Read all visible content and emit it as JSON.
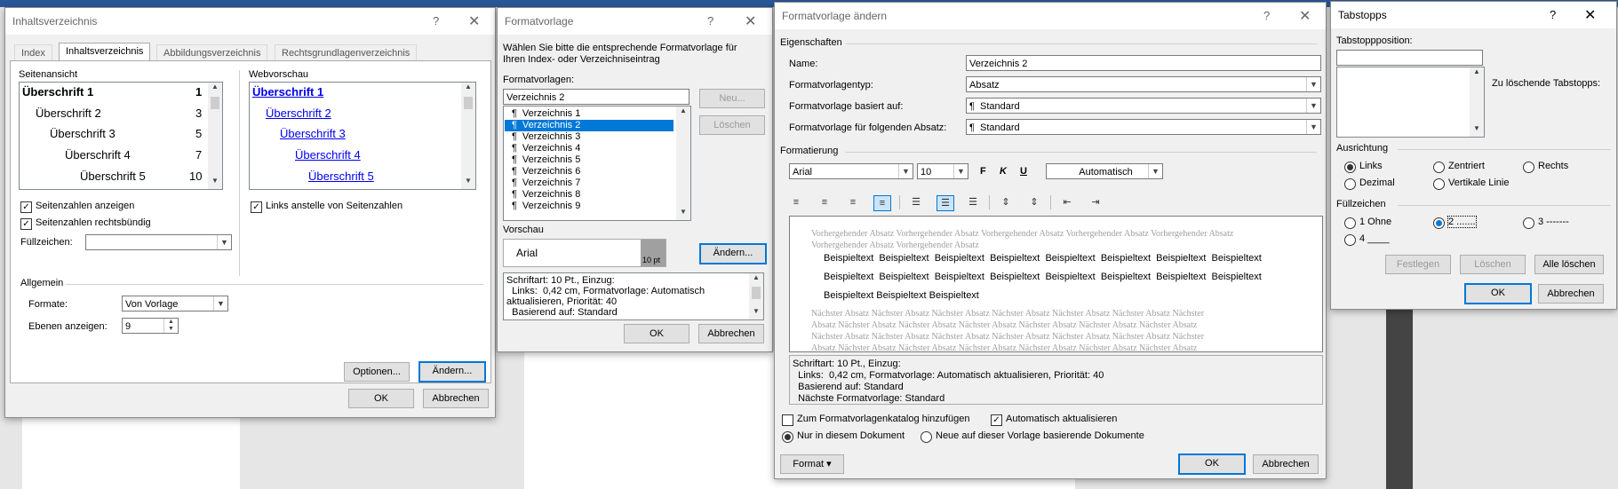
{
  "dlg1": {
    "title": "Inhaltsverzeichnis",
    "help": "?",
    "close": "✕",
    "tabs": [
      "Index",
      "Inhaltsverzeichnis",
      "Abbildungsverzeichnis",
      "Rechtsgrundlagenverzeichnis"
    ],
    "print_preview_label": "Seitenansicht",
    "print_preview": [
      {
        "text": "Überschrift 1",
        "page": "1"
      },
      {
        "text": "Überschrift 2",
        "page": "3"
      },
      {
        "text": "Überschrift 3",
        "page": "5"
      },
      {
        "text": "Überschrift 4",
        "page": "7"
      },
      {
        "text": "Überschrift 5",
        "page": "10"
      }
    ],
    "web_preview_label": "Webvorschau",
    "web_preview": [
      "Überschrift 1",
      "Überschrift 2",
      "Überschrift 3",
      "Überschrift 4",
      "Überschrift 5"
    ],
    "show_page_numbers": "Seitenzahlen anzeigen",
    "right_align": "Seitenzahlen rechtsbündig",
    "tab_leader_label": "Füllzeichen:",
    "tab_leader_value": "",
    "hyperlinks": "Links anstelle von Seitenzahlen",
    "general_label": "Allgemein",
    "formats_label": "Formate:",
    "formats_value": "Von Vorlage",
    "levels_label": "Ebenen anzeigen:",
    "levels_value": "9",
    "options_btn": "Optionen...",
    "modify_btn": "Ändern...",
    "ok": "OK",
    "cancel": "Abbrechen"
  },
  "dlg2": {
    "title": "Formatvorlage",
    "help": "?",
    "close": "✕",
    "instruction": "Wählen Sie bitte die entsprechende Formatvorlage für Ihren Index- oder Verzeichniseintrag",
    "styles_label": "Formatvorlagen:",
    "styles_value": "Verzeichnis 2",
    "styles": [
      "Verzeichnis 1",
      "Verzeichnis 2",
      "Verzeichnis 3",
      "Verzeichnis 4",
      "Verzeichnis 5",
      "Verzeichnis 6",
      "Verzeichnis 7",
      "Verzeichnis 8",
      "Verzeichnis 9"
    ],
    "selected_index": 1,
    "para_mark": "¶",
    "new_btn": "Neu...",
    "delete_btn": "Löschen",
    "preview_label": "Vorschau",
    "preview_font": "Arial",
    "preview_size": "10 pt",
    "modify_btn": "Ändern...",
    "description": [
      "Schriftart: 10 Pt., Einzug:",
      "  Links:  0,42 cm, Formatvorlage: Automatisch",
      "aktualisieren, Priorität: 40",
      "  Basierend auf: Standard"
    ],
    "ok": "OK",
    "cancel": "Abbrechen"
  },
  "dlg3": {
    "title": "Formatvorlage ändern",
    "help": "?",
    "close": "✕",
    "properties_label": "Eigenschaften",
    "name_label": "Name:",
    "name_value": "Verzeichnis 2",
    "type_label": "Formatvorlagentyp:",
    "type_value": "Absatz",
    "based_label": "Formatvorlage basiert auf:",
    "based_value": "¶  Standard",
    "next_label": "Formatvorlage für folgenden Absatz:",
    "next_value": "¶  Standard",
    "formatting_label": "Formatierung",
    "font": "Arial",
    "size": "10",
    "bold": "F",
    "italic": "K",
    "underline": "U",
    "color": "Automatisch",
    "prev_para": "Vorhergehender Absatz Vorhergehender Absatz Vorhergehender Absatz Vorhergehender Absatz Vorhergehender Absatz Vorhergehender Absatz Vorhergehender Absatz",
    "sample_line1": "Beispieltext  Beispieltext  Beispieltext  Beispieltext  Beispieltext  Beispieltext  Beispieltext  Beispieltext",
    "sample_line2": "Beispieltext  Beispieltext  Beispieltext  Beispieltext  Beispieltext  Beispieltext  Beispieltext  Beispieltext",
    "sample_line3": "Beispieltext Beispieltext Beispieltext",
    "next_para": [
      "Nächster Absatz Nächster Absatz Nächster Absatz Nächster Absatz Nächster Absatz Nächster Absatz Nächster",
      "Absatz Nächster Absatz Nächster Absatz Nächster Absatz Nächster Absatz Nächster Absatz Nächster Absatz",
      "Nächster Absatz Nächster Absatz Nächster Absatz Nächster Absatz Nächster Absatz Nächster Absatz Nächster",
      "Absatz Nächster Absatz Nächster Absatz Nächster Absatz Nächster Absatz Nächster Absatz Nächster Absatz"
    ],
    "description": [
      "Schriftart: 10 Pt., Einzug:",
      "  Links:  0,42 cm, Formatvorlage: Automatisch aktualisieren, Priorität: 40",
      "  Basierend auf: Standard",
      "  Nächste Formatvorlage: Standard"
    ],
    "add_gallery": "Zum Formatvorlagenkatalog hinzufügen",
    "auto_update": "Automatisch aktualisieren",
    "only_doc": "Nur in diesem Dokument",
    "new_docs": "Neue auf dieser Vorlage basierende Dokumente",
    "format_btn": "Format ▾",
    "ok": "OK",
    "cancel": "Abbrechen"
  },
  "dlg4": {
    "title": "Tabstopps",
    "help": "?",
    "close": "✕",
    "position_label": "Tabstoppposition:",
    "position_value": "",
    "clear_label": "Zu löschende Tabstopps:",
    "alignment_label": "Ausrichtung",
    "align": [
      "Links",
      "Zentriert",
      "Rechts",
      "Dezimal",
      "Vertikale Linie"
    ],
    "leader_label": "Füllzeichen",
    "leaders": [
      "1 Ohne",
      "2 .......",
      "3 -------",
      "4 ____"
    ],
    "set_btn": "Festlegen",
    "clear_btn": "Löschen",
    "clear_all_btn": "Alle löschen",
    "ok": "OK",
    "cancel": "Abbrechen"
  },
  "colors": {
    "selection": "#0078d7",
    "link": "#0000ee",
    "ribbon": "#2b579a"
  }
}
